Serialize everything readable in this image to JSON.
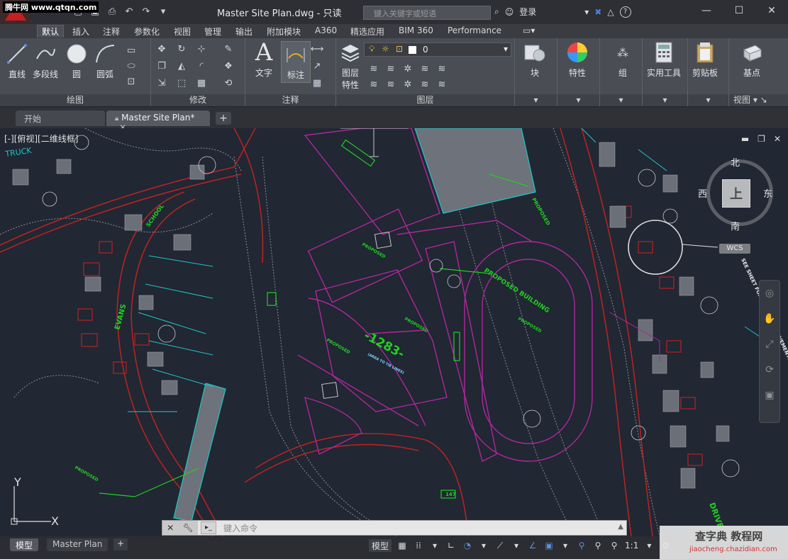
{
  "watermark_top": "腾牛网 www.qtqn.com",
  "title": {
    "document": "Master Site Plan.dwg - 只读",
    "search_placeholder": "键入关键字或短语",
    "login": "登录",
    "help": "?"
  },
  "ribbon_tabs": [
    "默认",
    "插入",
    "注释",
    "参数化",
    "视图",
    "管理",
    "输出",
    "附加模块",
    "A360",
    "精选应用",
    "BIM 360",
    "Performance"
  ],
  "ribbon": {
    "draw": {
      "label": "绘图",
      "tools": [
        "直线",
        "多段线",
        "圆",
        "圆弧"
      ]
    },
    "modify": {
      "label": "修改"
    },
    "annotation": {
      "label": "注释",
      "tools": [
        "文字",
        "标注"
      ]
    },
    "layers": {
      "label": "图层",
      "tool": "图层特性",
      "current_layer": "0"
    },
    "block": {
      "label": "块"
    },
    "properties": {
      "label": "特性"
    },
    "group": {
      "label": "组"
    },
    "utilities": {
      "label": "实用工具"
    },
    "clipboard": {
      "label": "剪贴板"
    },
    "base": {
      "label": "基点"
    },
    "view": {
      "label": "视图"
    }
  },
  "file_tabs": {
    "start": "开始",
    "current": "Master Site Plan*"
  },
  "viewport": {
    "label": "[-][俯视][二维线框]",
    "viewcube": {
      "north": "北",
      "south": "南",
      "east": "东",
      "west": "西",
      "face": "上"
    },
    "wcs": "WCS"
  },
  "drawing_text": {
    "label_1283": "-1283-",
    "label_area": "(AREA TO TIE LINES)",
    "label_147": "147",
    "proposed_building": "PROPOSED BUILDING",
    "drive": "DRIVE",
    "see_sheet": "SEE SHEET FOR LIST OF IMPROVEMENTS"
  },
  "ucs": {
    "x": "X",
    "y": "Y"
  },
  "command": {
    "placeholder": "键入命令"
  },
  "status": {
    "model_tab": "模型",
    "layout_tab": "Master Plan",
    "model_button": "模型",
    "scale": "1:1"
  },
  "watermark_bottom": {
    "title": "查字典 教程网",
    "url": "jiaocheng.chazidian.com"
  },
  "colors": {
    "accent": "#5d8edb",
    "magenta": "#b0279e",
    "green": "#21d021",
    "cyan": "#1ec7c7",
    "red": "#b52323"
  }
}
